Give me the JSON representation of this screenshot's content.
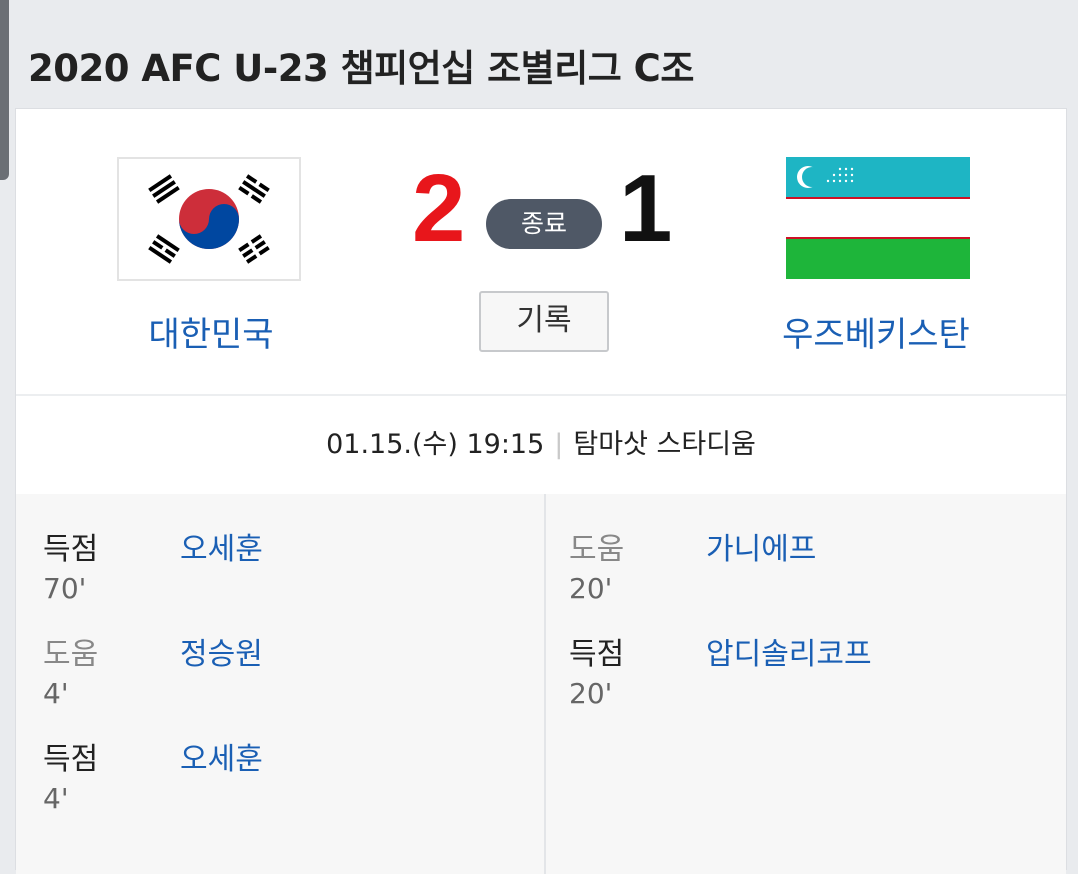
{
  "title": "2020 AFC U-23 챔피언십 조별리그 C조",
  "match": {
    "home": {
      "name": "대한민국",
      "score": "2",
      "flag": "south-korea-flag"
    },
    "away": {
      "name": "우즈베키스탄",
      "score": "1",
      "flag": "uzbekistan-flag"
    },
    "status": "종료",
    "record_label": "기록",
    "datetime": "01.15.(수) 19:15",
    "venue": "탐마삿 스타디움"
  },
  "events": {
    "home": [
      {
        "type": "득점",
        "player": "오세훈",
        "minute": "70'"
      },
      {
        "type": "도움",
        "player": "정승원",
        "minute": "4'"
      },
      {
        "type": "득점",
        "player": "오세훈",
        "minute": "4'"
      }
    ],
    "away": [
      {
        "type": "도움",
        "player": "가니에프",
        "minute": "20'"
      },
      {
        "type": "득점",
        "player": "압디솔리코프",
        "minute": "20'"
      }
    ]
  },
  "colors": {
    "home_score": "#e8161b",
    "away_score": "#111111",
    "link": "#1a5fb4",
    "status_pill": "#4f5866"
  }
}
